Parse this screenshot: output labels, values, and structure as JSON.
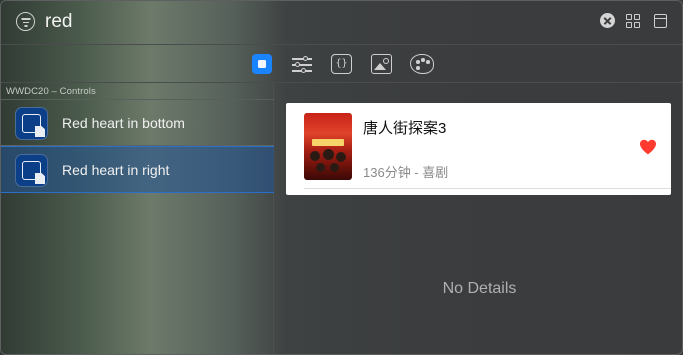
{
  "search": {
    "query": "red"
  },
  "toolbar": {
    "tabs": [
      "preview",
      "attributes",
      "code",
      "image",
      "palette"
    ],
    "active": "preview",
    "code_glyph": "{}"
  },
  "sidebar": {
    "section_title": "WWDC20 – Controls",
    "items": [
      {
        "label": "Red heart in bottom",
        "selected": false
      },
      {
        "label": "Red heart in right",
        "selected": true
      }
    ]
  },
  "card": {
    "title": "唐人街探案3",
    "subtitle": "136分钟 - 喜剧",
    "heart_color": "#ff3b30"
  },
  "detail": {
    "empty_text": "No Details"
  },
  "colors": {
    "accent": "#1a84ff",
    "selection": "#215396"
  }
}
